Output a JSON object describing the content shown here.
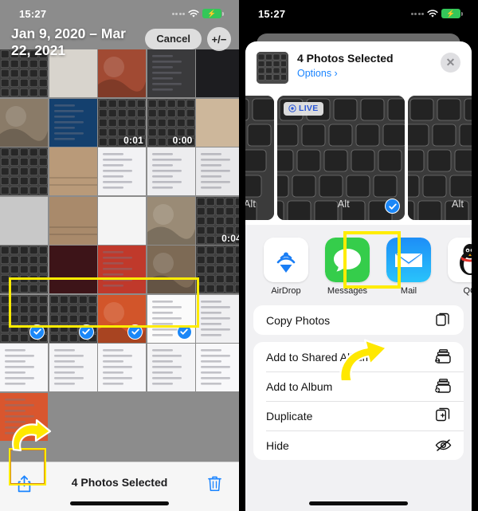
{
  "left_panel": {
    "status_bar": {
      "time": "15:27",
      "wifi_icon": "wifi-icon",
      "battery_icon": "battery-charging-icon"
    },
    "header": {
      "title": "Jan 9, 2020 – Mar 22, 2021",
      "cancel_label": "Cancel",
      "zoom_toggle_label": "+/−"
    },
    "grid": {
      "columns": 5,
      "video_durations": [
        "0:01",
        "0:00",
        "0:04"
      ],
      "selected_count": 4,
      "selected_row_highlight_color": "#ffec00"
    },
    "toolbar": {
      "share_icon": "share-icon",
      "status_label": "4 Photos Selected",
      "trash_icon": "trash-icon",
      "highlight_color": "#ffec00"
    }
  },
  "right_panel": {
    "status_bar": {
      "time": "15:27",
      "wifi_icon": "wifi-icon",
      "battery_icon": "battery-charging-icon"
    },
    "share_sheet": {
      "title": "4 Photos Selected",
      "options_label": "Options ›",
      "close_icon": "close-icon",
      "live_badge": "LIVE",
      "apps": [
        {
          "label": "AirDrop",
          "icon": "airdrop-icon",
          "highlighted": false
        },
        {
          "label": "Messages",
          "icon": "messages-icon",
          "highlighted": false
        },
        {
          "label": "Mail",
          "icon": "mail-icon",
          "highlighted": true
        },
        {
          "label": "QQ",
          "icon": "qq-icon",
          "highlighted": false
        },
        {
          "label": "",
          "icon": "notes-icon",
          "highlighted": false
        }
      ],
      "actions_primary": [
        {
          "label": "Copy Photos",
          "icon": "copy-icon"
        }
      ],
      "actions_secondary": [
        {
          "label": "Add to Shared Album",
          "icon": "shared-album-icon"
        },
        {
          "label": "Add to Album",
          "icon": "add-album-icon"
        },
        {
          "label": "Duplicate",
          "icon": "duplicate-icon"
        },
        {
          "label": "Hide",
          "icon": "hide-icon"
        }
      ],
      "highlight_color": "#ffec00"
    }
  }
}
